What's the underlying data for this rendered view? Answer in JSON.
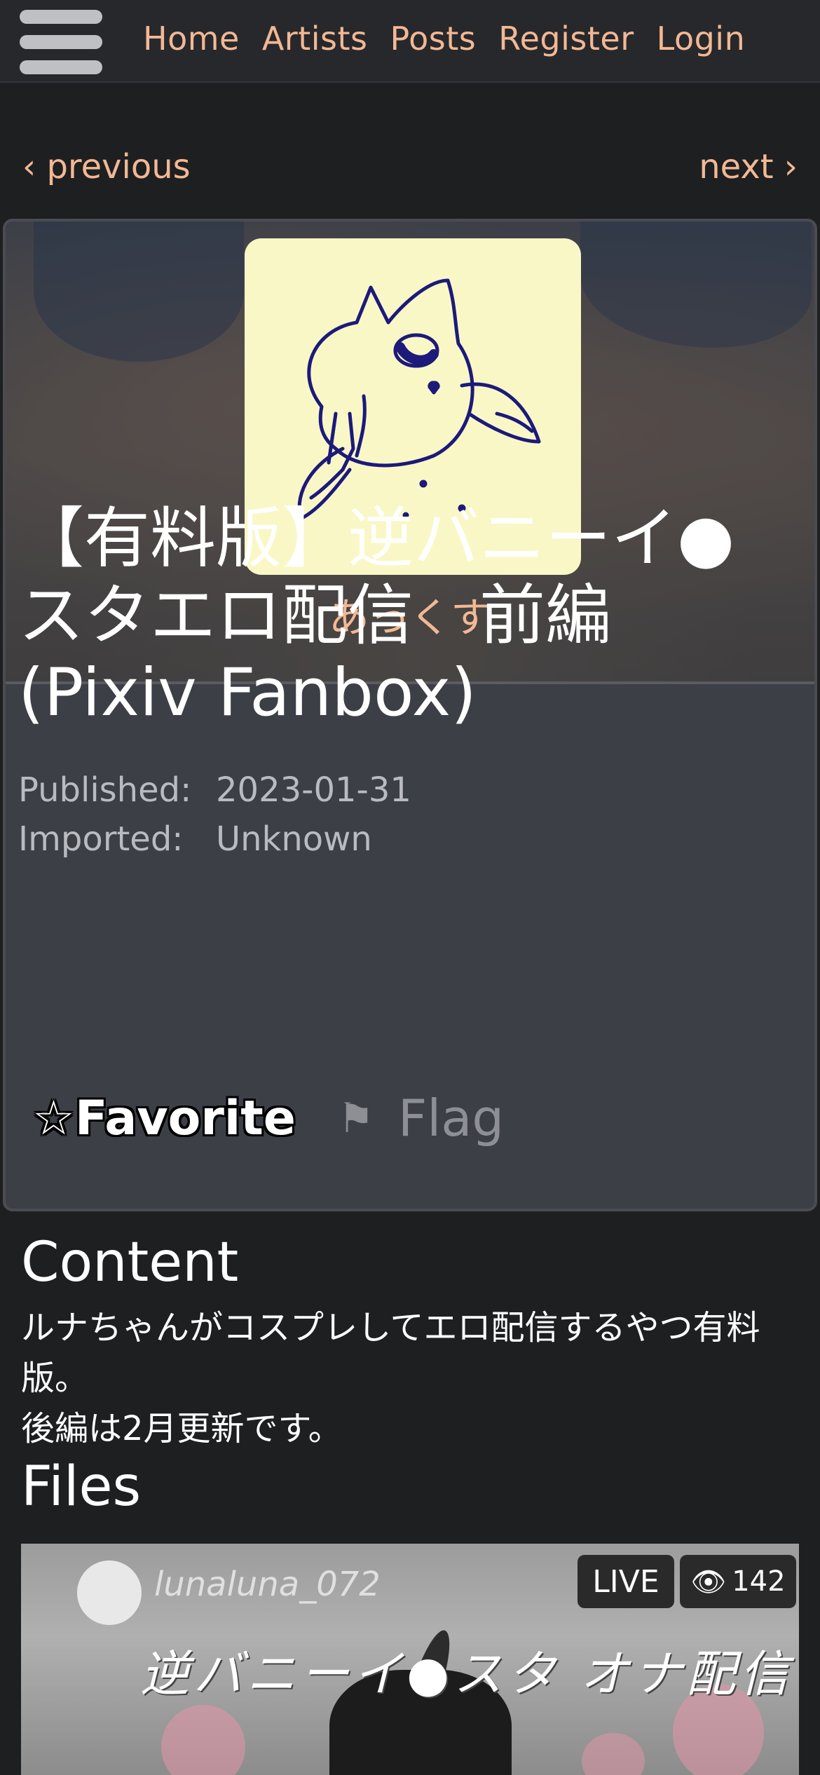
{
  "nav": {
    "menu_icon": "hamburger-menu-icon",
    "links": [
      "Home",
      "Artists",
      "Posts",
      "Register",
      "Login"
    ]
  },
  "pager": {
    "previous": "‹ previous",
    "next": "next ›"
  },
  "artist": {
    "name": "あっくす"
  },
  "post": {
    "title": "【有料版】逆バニーイ●スタエロ配信　前編 (Pixiv Fanbox)",
    "published_label": "Published:",
    "published_value": "2023-01-31",
    "imported_label": "Imported:",
    "imported_value": "Unknown",
    "favorite_label": "☆Favorite",
    "flag_icon": "⚑",
    "flag_label": "Flag"
  },
  "content": {
    "heading": "Content",
    "line1": "ルナちゃんがコスプレしてエロ配信するやつ有料版。",
    "line2": "後編は2月更新です。"
  },
  "files": {
    "heading": "Files",
    "thumb_username": "lunaluna_072",
    "thumb_live": "LIVE",
    "thumb_views": "142",
    "thumb_caption": "逆バニーイ●スタ オナ配信"
  },
  "colors": {
    "accent_link": "#f2b894",
    "nav_bg": "#27282c",
    "page_bg": "#1e1f21",
    "card_bg": "#3c3f46",
    "avatar_bg": "#f9f7c6",
    "avatar_ink": "#1c1a7a"
  }
}
